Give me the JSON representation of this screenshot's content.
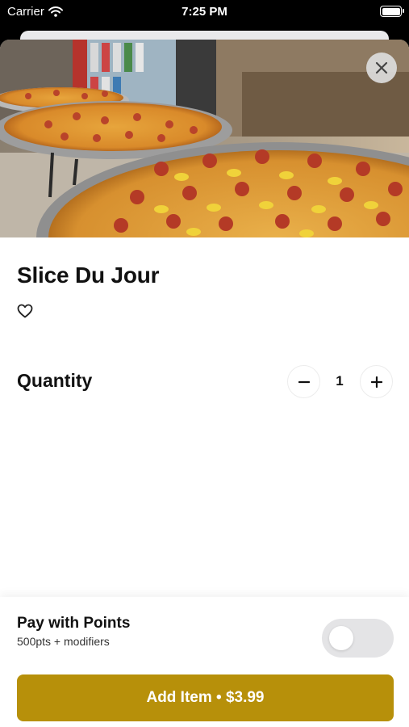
{
  "status_bar": {
    "carrier": "Carrier",
    "time": "7:25 PM",
    "battery_level": 1.0
  },
  "item": {
    "title": "Slice Du Jour",
    "favorite": false
  },
  "quantity": {
    "label": "Quantity",
    "value": "1"
  },
  "footer": {
    "pay_title": "Pay with Points",
    "pay_subtitle": "500pts + modifiers",
    "toggle_on": false,
    "add_button_label": "Add Item • $3.99"
  },
  "colors": {
    "accent": "#b7900a",
    "toggle_off": "#e4e4e6"
  },
  "icons": [
    "wifi-icon",
    "battery-icon",
    "close-icon",
    "heart-icon",
    "minus-icon",
    "plus-icon"
  ]
}
